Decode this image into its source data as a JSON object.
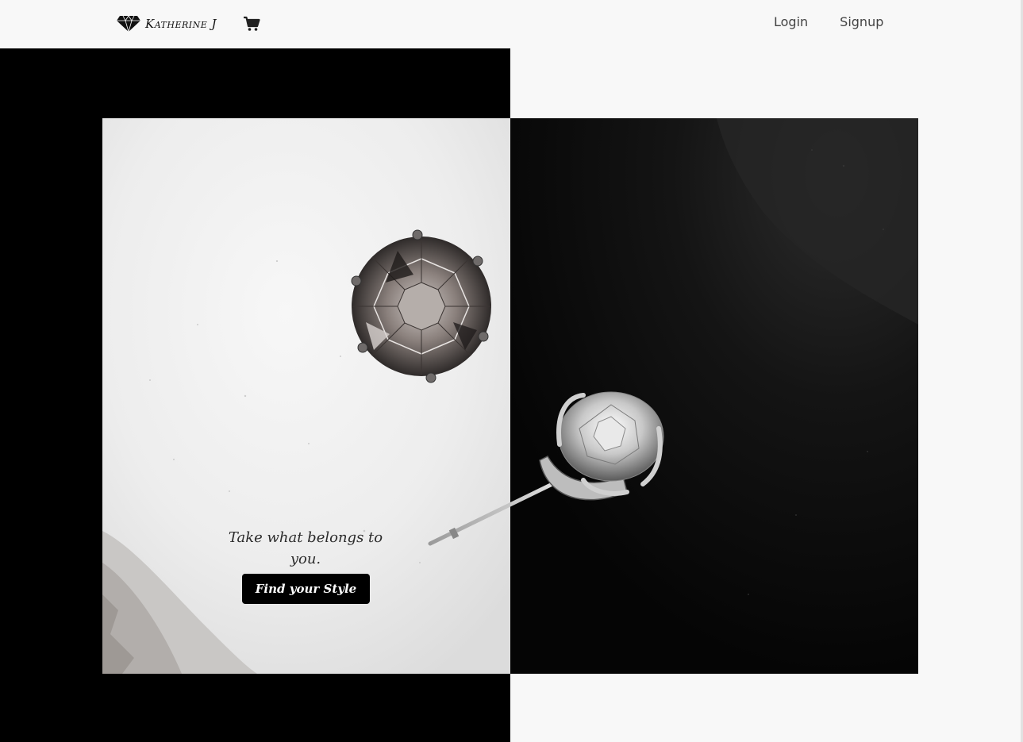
{
  "navbar": {
    "brand_name": "Katherine J",
    "brand_icon": "diamond-icon",
    "cart_icon": "shopping-cart-icon",
    "links": {
      "login": "Login",
      "signup": "Signup"
    }
  },
  "hero": {
    "tagline": "Take what belongs to you.",
    "cta_label": "Find your Style"
  },
  "colors": {
    "background": "#f8f8f8",
    "accent_dark": "#000000",
    "text": "#444444",
    "button_text": "#ffffff"
  }
}
